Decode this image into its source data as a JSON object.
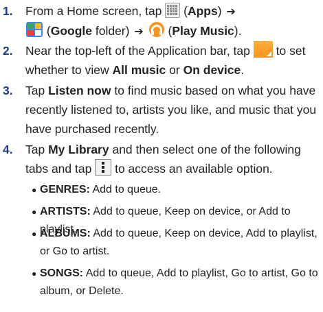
{
  "steps": [
    {
      "num": "1.",
      "pre": "From a Home screen, tap",
      "b1": "Apps",
      "b2": "Google",
      "mid": "folder)",
      "b3": "Play Music",
      "end": ")."
    },
    {
      "num": "2.",
      "pre": "Near the top-left of the Application bar, tap",
      "post": "to set whether to view",
      "b1": "All music",
      "or": "or",
      "b2": "On device",
      "end": "."
    },
    {
      "num": "3.",
      "pre": "Tap",
      "b1": "Listen now",
      "post": "to find music based on what you have recently listened to, artists you like, and music that you have purchased recently."
    },
    {
      "num": "4.",
      "pre": "Tap",
      "b1": "My Library",
      "mid": "and then select one of the following tabs and tap",
      "post": "to access an available option."
    }
  ],
  "tabs": [
    {
      "label": "GENRES:",
      "text": "Add to queue."
    },
    {
      "label": "ARTISTS:",
      "text": "Add to queue, Keep on device, or Add to playlist."
    },
    {
      "label": "ALBUMS:",
      "text": "Add to queue, Keep on device, Add to playlist, or Go to artist."
    },
    {
      "label": "SONGS:",
      "text": "Add to queue, Add to playlist, Go to artist, Go to album, or Delete."
    }
  ],
  "icons": {
    "apps": "apps-grid-icon",
    "google_folder": "google-folder-icon",
    "play_music": "play-music-icon",
    "dropdown": "view-dropdown-icon",
    "menu": "menu-options-icon"
  },
  "colors": {
    "step_number": "#1a3a8a",
    "dropdown": "#f7931e"
  }
}
